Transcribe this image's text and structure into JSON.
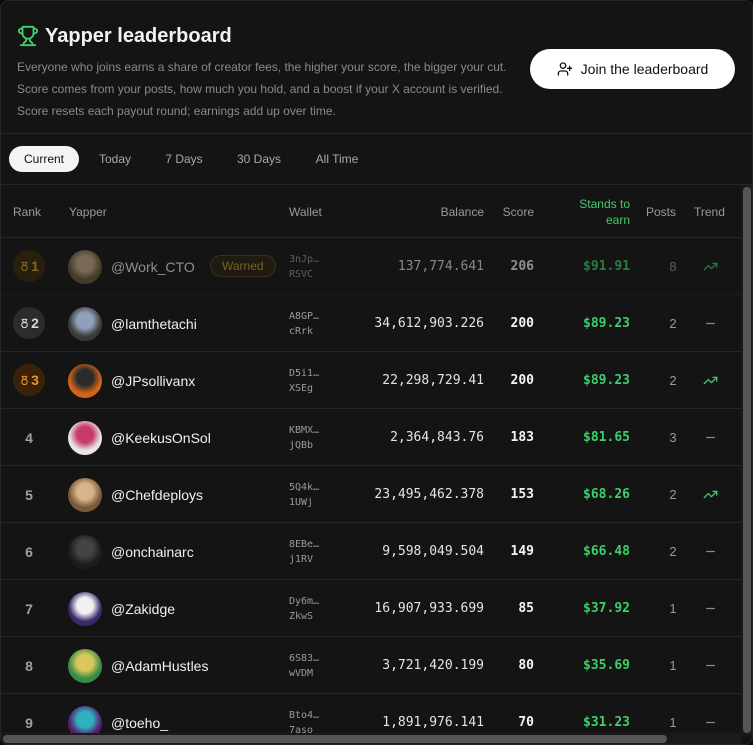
{
  "header": {
    "title": "Yapper leaderboard",
    "description": "Everyone who joins earns a share of creator fees, the higher your score, the bigger your cut. Score comes from your posts, how much you hold, and a boost if your X account is verified. Score resets each payout round; earnings add up over time.",
    "join_label": "Join the leaderboard",
    "accent": "#3ccf6a"
  },
  "tabs": [
    {
      "label": "Current",
      "active": true
    },
    {
      "label": "Today",
      "active": false
    },
    {
      "label": "7 Days",
      "active": false
    },
    {
      "label": "30 Days",
      "active": false
    },
    {
      "label": "All Time",
      "active": false
    }
  ],
  "columns": {
    "rank": "Rank",
    "yapper": "Yapper",
    "wallet": "Wallet",
    "balance": "Balance",
    "score": "Score",
    "earn": "Stands to earn",
    "posts": "Posts",
    "trend": "Trend"
  },
  "rows": [
    {
      "rank": "1",
      "handle": "@Work_CTO",
      "badge": "Warned",
      "wallet1": "3nJp…",
      "wallet2": "RSVC",
      "balance": "137,774.641",
      "score": "206",
      "earn": "$91.91",
      "posts": "8",
      "trend": "up-trend-icon"
    },
    {
      "rank": "2",
      "handle": "@lamthetachi",
      "badge": "",
      "wallet1": "A8GP…",
      "wallet2": "cRrk",
      "balance": "34,612,903.226",
      "score": "200",
      "earn": "$89.23",
      "posts": "2",
      "trend": "flat-trend-icon"
    },
    {
      "rank": "3",
      "handle": "@JPsollivanx",
      "badge": "",
      "wallet1": "D5i1…",
      "wallet2": "XSEg",
      "balance": "22,298,729.41",
      "score": "200",
      "earn": "$89.23",
      "posts": "2",
      "trend": "up-trend-icon"
    },
    {
      "rank": "4",
      "handle": "@KeekusOnSol",
      "badge": "",
      "wallet1": "KBMX…",
      "wallet2": "jQBb",
      "balance": "2,364,843.76",
      "score": "183",
      "earn": "$81.65",
      "posts": "3",
      "trend": "flat-trend-icon"
    },
    {
      "rank": "5",
      "handle": "@Chefdeploys",
      "badge": "",
      "wallet1": "5Q4k…",
      "wallet2": "1UWj",
      "balance": "23,495,462.378",
      "score": "153",
      "earn": "$68.26",
      "posts": "2",
      "trend": "up-trend-icon"
    },
    {
      "rank": "6",
      "handle": "@onchainarc",
      "badge": "",
      "wallet1": "8EBe…",
      "wallet2": "j1RV",
      "balance": "9,598,049.504",
      "score": "149",
      "earn": "$66.48",
      "posts": "2",
      "trend": "flat-trend-icon"
    },
    {
      "rank": "7",
      "handle": "@Zakidge",
      "badge": "",
      "wallet1": "Dy6m…",
      "wallet2": "ZkwS",
      "balance": "16,907,933.699",
      "score": "85",
      "earn": "$37.92",
      "posts": "1",
      "trend": "flat-trend-icon"
    },
    {
      "rank": "8",
      "handle": "@AdamHustles",
      "badge": "",
      "wallet1": "6S83…",
      "wallet2": "wVDM",
      "balance": "3,721,420.199",
      "score": "80",
      "earn": "$35.69",
      "posts": "1",
      "trend": "flat-trend-icon"
    },
    {
      "rank": "9",
      "handle": "@toeho_",
      "badge": "",
      "wallet1": "Bto4…",
      "wallet2": "7aso",
      "balance": "1,891,976.141",
      "score": "70",
      "earn": "$31.23",
      "posts": "1",
      "trend": "flat-trend-icon"
    }
  ]
}
